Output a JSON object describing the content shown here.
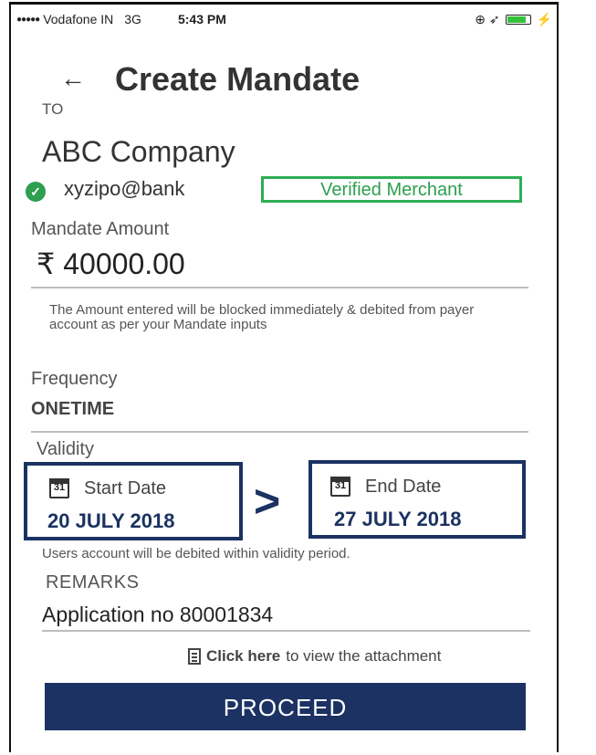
{
  "status_bar": {
    "signal": "●●●●●",
    "carrier": "Vodafone IN",
    "network": "3G",
    "time": "5:43 PM",
    "icons": "⊕ ➶"
  },
  "header": {
    "back_icon": "←",
    "title": "Create Mandate"
  },
  "payee": {
    "to_label": "TO",
    "name": "ABC Company",
    "check_icon": "✓",
    "vpa": "xyzipo@bank",
    "badge": "Verified Merchant",
    "badge_color": "#2eae55"
  },
  "amount": {
    "label": "Mandate Amount",
    "value": "₹ 40000.00",
    "note": "The Amount entered will be blocked immediately & debited from payer account as per your Mandate inputs"
  },
  "frequency": {
    "label": "Frequency",
    "value": "ONETIME"
  },
  "validity": {
    "label": "Validity",
    "calendar_day": "31",
    "start_label": "Start Date",
    "start_value": "20 JULY 2018",
    "separator": ">",
    "end_label": "End Date",
    "end_value": "27 JULY 2018",
    "note": "Users account will be debited within validity period."
  },
  "remarks": {
    "label": "REMARKS",
    "value": "Application no 80001834"
  },
  "attachment": {
    "link_text": "Click here",
    "rest_text": "to view the attachment"
  },
  "proceed_label": "PROCEED",
  "colors": {
    "primary": "#1b3262",
    "verified": "#2eae55"
  }
}
